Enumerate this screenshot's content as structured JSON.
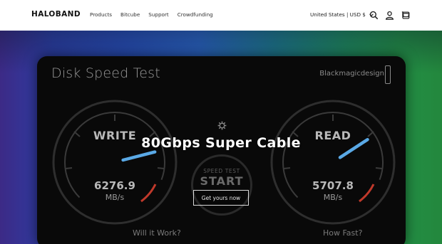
{
  "header": {
    "logo": "HALOBAND",
    "nav": [
      "Products",
      "Bitcube",
      "Support",
      "Crowdfunding"
    ],
    "region": "United States | USD $",
    "icons": [
      "search-icon",
      "account-icon",
      "cart-icon"
    ]
  },
  "hero": {
    "title": "80Gbps Super Cable",
    "cta": "Get yours now",
    "panel": {
      "title": "Disk Speed Test",
      "brand": "Blackmagicdesign",
      "write": {
        "label": "WRITE",
        "value": "6276.9",
        "unit": "MB/s",
        "level": 0.78
      },
      "read": {
        "label": "READ",
        "value": "5707.8",
        "unit": "MB/s",
        "level": 0.71
      },
      "start_small": "SPEED TEST",
      "start_big": "START",
      "bottom_left": "Will it Work?",
      "bottom_right": "How Fast?"
    }
  },
  "colors": {
    "needle": "#5aa9e6",
    "red_zone": "#c0392b",
    "gauge_ring": "#3a3a3a"
  }
}
